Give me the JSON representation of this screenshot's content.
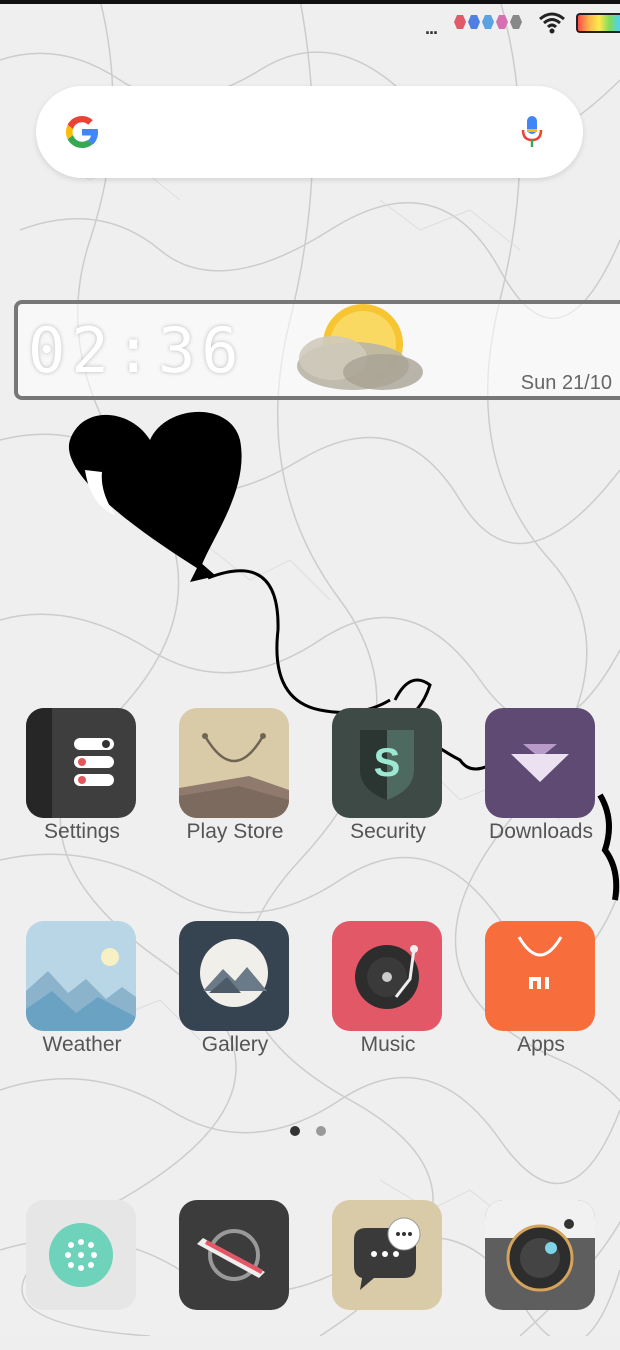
{
  "status_bar": {
    "overflow": "...",
    "dot_colors": [
      "#e05a6a",
      "#4f7fe0",
      "#5aa3e0",
      "#d470b0",
      "#888888"
    ]
  },
  "search": {
    "logo": "google-logo",
    "voice_icon": "mic-icon"
  },
  "clock_widget": {
    "time": "02:36",
    "date": "Sun 21/10",
    "weather_icon": "partly-cloudy-icon"
  },
  "home": {
    "row1": [
      {
        "label": "Settings",
        "icon": "settings-icon"
      },
      {
        "label": "Play Store",
        "icon": "shopping-bag-icon"
      },
      {
        "label": "Security",
        "icon": "shield-icon"
      },
      {
        "label": "Downloads",
        "icon": "download-icon"
      }
    ],
    "row2": [
      {
        "label": "Weather",
        "icon": "weather-icon"
      },
      {
        "label": "Gallery",
        "icon": "mountain-icon"
      },
      {
        "label": "Music",
        "icon": "record-icon"
      },
      {
        "label": "Apps",
        "icon": "mi-bag-icon"
      }
    ]
  },
  "page_indicator": {
    "pages": 2,
    "current": 1
  },
  "dock": [
    {
      "icon": "phone-dialer-icon"
    },
    {
      "icon": "compass-browser-icon"
    },
    {
      "icon": "messages-icon"
    },
    {
      "icon": "camera-icon"
    }
  ],
  "colors": {
    "accent": "#4285f4",
    "settings_bg": "#3e3e3e",
    "playstore_bg": "#d9cba8",
    "security_bg": "#3d4a45",
    "downloads_bg": "#5f4a73",
    "gallery_bg": "#364451",
    "music_bg": "#e25866",
    "apps_bg": "#f86d3c"
  }
}
